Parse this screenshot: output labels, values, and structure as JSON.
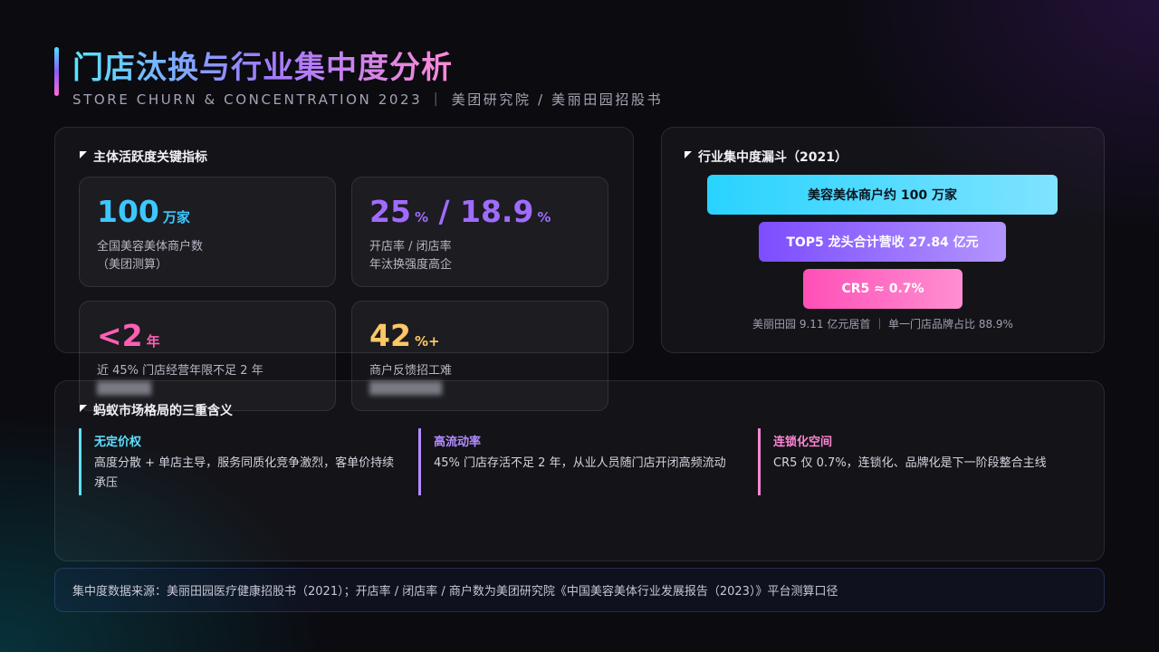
{
  "header": {
    "title": "门店汰换与行业集中度分析",
    "subtitle": "STORE CHURN & CONCENTRATION 2023 ｜ 美团研究院 / 美丽田园招股书"
  },
  "metrics": {
    "heading": "主体活跃度关键指标",
    "cards": [
      {
        "value": "100",
        "unit": "万家",
        "line1": "全国美容美体商户数",
        "line2": "（美团测算）",
        "color": "#3cc8ff"
      },
      {
        "value": "25",
        "unit": "%",
        "value_b": " / 18.9",
        "unit_b": "%",
        "line1": "开店率 / 闭店率",
        "line2": "年汰换强度高企",
        "color": "#a06bff"
      },
      {
        "value": "<2",
        "unit": "年",
        "line1": "近 45% 门店经营年限不足 2 年",
        "line2": "",
        "color": "#ff5fb5"
      },
      {
        "value": "42",
        "unit": "%+",
        "line1": "商户反馈招工难",
        "line2": "",
        "color": "#ffc766"
      }
    ]
  },
  "funnel": {
    "heading": "行业集中度漏斗（2021）",
    "levels": [
      {
        "label": "美容美体商户约 100 万家",
        "color_from": "#28d3ff",
        "color_to": "#7fe3ff",
        "text_color": "#0a1420"
      },
      {
        "label": "TOP5 龙头合计营收 27.84 亿元",
        "color_from": "#7c4dff",
        "color_to": "#b394ff",
        "text_color": "#ffffff"
      },
      {
        "label": "CR5 ≈ 0.7%",
        "color_from": "#ff4fb8",
        "color_to": "#ff8fd0",
        "text_color": "#ffffff"
      }
    ],
    "note": "美丽田园 9.11 亿元居首 ｜ 单一门店品牌占比 88.9%"
  },
  "meanings": {
    "heading": "蚂蚁市场格局的三重含义",
    "items": [
      {
        "title": "无定价权",
        "text": "高度分散 + 单店主导，服务同质化竞争激烈，客单价持续承压",
        "color": "#5fe0ff"
      },
      {
        "title": "高流动率",
        "text": "45% 门店存活不足 2 年，从业人员随门店开闭高频流动",
        "color": "#b48cff"
      },
      {
        "title": "连锁化空间",
        "text": "CR5 仅 0.7%，连锁化、品牌化是下一阶段整合主线",
        "color": "#ff86d4"
      }
    ]
  },
  "source": {
    "text": "集中度数据来源：美丽田园医疗健康招股书（2021）；开店率 / 闭店率 / 商户数为美团研究院《中国美容美体行业发展报告（2023）》平台测算口径"
  }
}
